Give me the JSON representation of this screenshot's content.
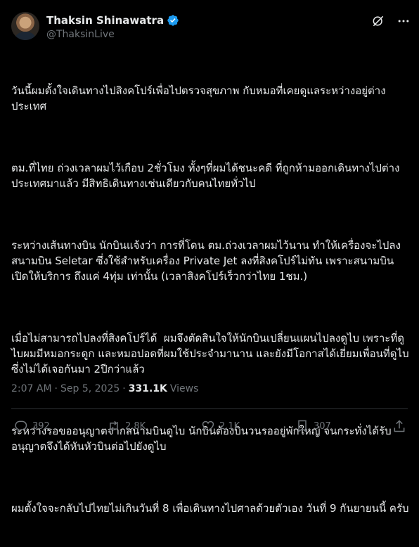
{
  "author": {
    "name": "Thaksin Shinawatra",
    "handle": "@ThaksinLive"
  },
  "post": {
    "paragraphs": [
      "วันนี้ผมตั้งใจเดินทางไปสิงคโปร์เพื่อไปตรวจสุขภาพ กับหมอที่เคยดูแลระหว่างอยู่ต่างประเทศ",
      "ตม.ที่ไทย ถ่วงเวลาผมไว้เกือบ 2ชั่วโมง ทั้งๆที่ผมได้ชนะคดี ที่ถูกห้ามออกเดินทางไปต่างประเทศมาแล้ว มีสิทธิเดินทางเช่นเดียวกับคนไทยทั่วไป",
      "ระหว่างเส้นทางบิน นักบินแจ้งว่า การที่โดน ตม.ถ่วงเวลาผมไว้นาน ทำให้เครื่องจะไปลงสนามบิน Seletar ซึ่งใช้สำหรับเครื่อง Private Jet ลงที่สิงคโปร์ไม่ทัน เพราะสนามบินเปิดให้บริการ ถึงแค่ 4ทุ่ม เท่านั้น (เวลาสิงคโปร์เร็วกว่าไทย 1ชม.)",
      "เมื่อไม่สามารถไปลงที่สิงคโปร์ได้  ผมจึงตัดสินใจให้นักบินเปลี่ยนแผนไปลงดูไบ เพราะที่ดูไบผมมีหมอกระดูก และหมอปอดที่ผมใช้ประจำมานาน และยังมีโอกาสได้เยี่ยมเพื่อนที่ดูไบ ซึ่งไม่ได้เจอกันมา 2ปีกว่าแล้ว",
      "ระหว่างรอขออนุญาตจากสนามบินดูไบ นักบินต้องบินวนรออยู่พักใหญ่ จนกระทั่งได้รับอนุญาตจึงได้หันหัวบินต่อไปยังดูไบ",
      "ผมตั้งใจจะกลับไปไทยไม่เกินวันที่ 8 เพื่อเดินทางไปศาลด้วยตัวเอง วันที่ 9 กันยายนนี้ ครับ"
    ],
    "time": "2:07 AM",
    "separator": "·",
    "date": "Sep 5, 2025",
    "views_count": "331.1K",
    "views_label": "Views"
  },
  "actions": {
    "replies": "392",
    "reposts": "2.8K",
    "likes": "2.1K",
    "bookmarks": "307"
  },
  "icons": {
    "verified": "verified-badge-icon",
    "grok": "grok-icon",
    "more": "more-icon",
    "reply": "reply-icon",
    "repost": "repost-icon",
    "like": "heart-icon",
    "bookmark": "bookmark-icon",
    "share": "share-icon"
  },
  "colors": {
    "background": "#000000",
    "text": "#e7e9ea",
    "muted": "#71767b",
    "verified": "#1d9bf0",
    "divider": "#2f3336"
  }
}
